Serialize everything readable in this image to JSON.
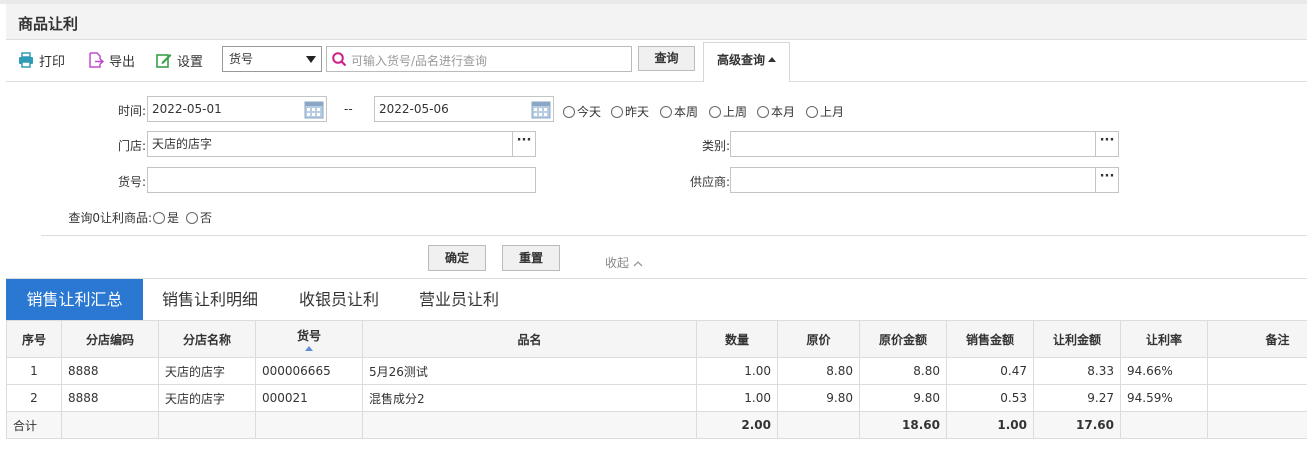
{
  "window": {
    "title": "商品让利"
  },
  "toolbar": {
    "print_label": "打印",
    "export_label": "导出",
    "settings_label": "设置",
    "field_select": "货号",
    "search_placeholder": "可输入货号/品名进行查询",
    "query_label": "查询",
    "advanced_label": "高级查询"
  },
  "filter": {
    "time_label": "时间:",
    "date_from": "2022-05-01",
    "date_sep": "--",
    "date_to": "2022-05-06",
    "quick_dates": [
      "今天",
      "昨天",
      "本周",
      "上周",
      "本月",
      "上月"
    ],
    "store_label": "门店:",
    "store_value": "天店的店字",
    "category_label": "类别:",
    "category_value": "",
    "item_no_label": "货号:",
    "item_no_value": "",
    "supplier_label": "供应商:",
    "supplier_value": "",
    "zero_label": "查询0让利商品:",
    "zero_yes": "是",
    "zero_no": "否",
    "confirm_label": "确定",
    "reset_label": "重置",
    "collapse_label": "收起",
    "more_label": "···"
  },
  "tabs": [
    {
      "label": "销售让利汇总",
      "active": true
    },
    {
      "label": "销售让利明细",
      "active": false
    },
    {
      "label": "收银员让利",
      "active": false
    },
    {
      "label": "营业员让利",
      "active": false
    }
  ],
  "table": {
    "headers": [
      "序号",
      "分店编码",
      "分店名称",
      "货号",
      "品名",
      "数量",
      "原价",
      "原价金额",
      "销售金额",
      "让利金额",
      "让利率",
      "备注"
    ],
    "rows": [
      [
        "1",
        "8888",
        "天店的店字",
        "000006665",
        "5月26测试",
        "1.00",
        "8.80",
        "8.80",
        "0.47",
        "8.33",
        "94.66%",
        ""
      ],
      [
        "2",
        "8888",
        "天店的店字",
        "000021",
        "混售成分2",
        "1.00",
        "9.80",
        "9.80",
        "0.53",
        "9.27",
        "94.59%",
        ""
      ]
    ],
    "total": [
      "合计",
      "",
      "",
      "",
      "",
      "2.00",
      "",
      "18.60",
      "1.00",
      "17.60",
      "",
      ""
    ]
  },
  "colors": {
    "accent": "#2a78d2",
    "print_icon": "#2f9bb5",
    "export_icon": "#c04bd0",
    "settings_icon": "#3aa046",
    "search_icon": "#d0218a"
  }
}
